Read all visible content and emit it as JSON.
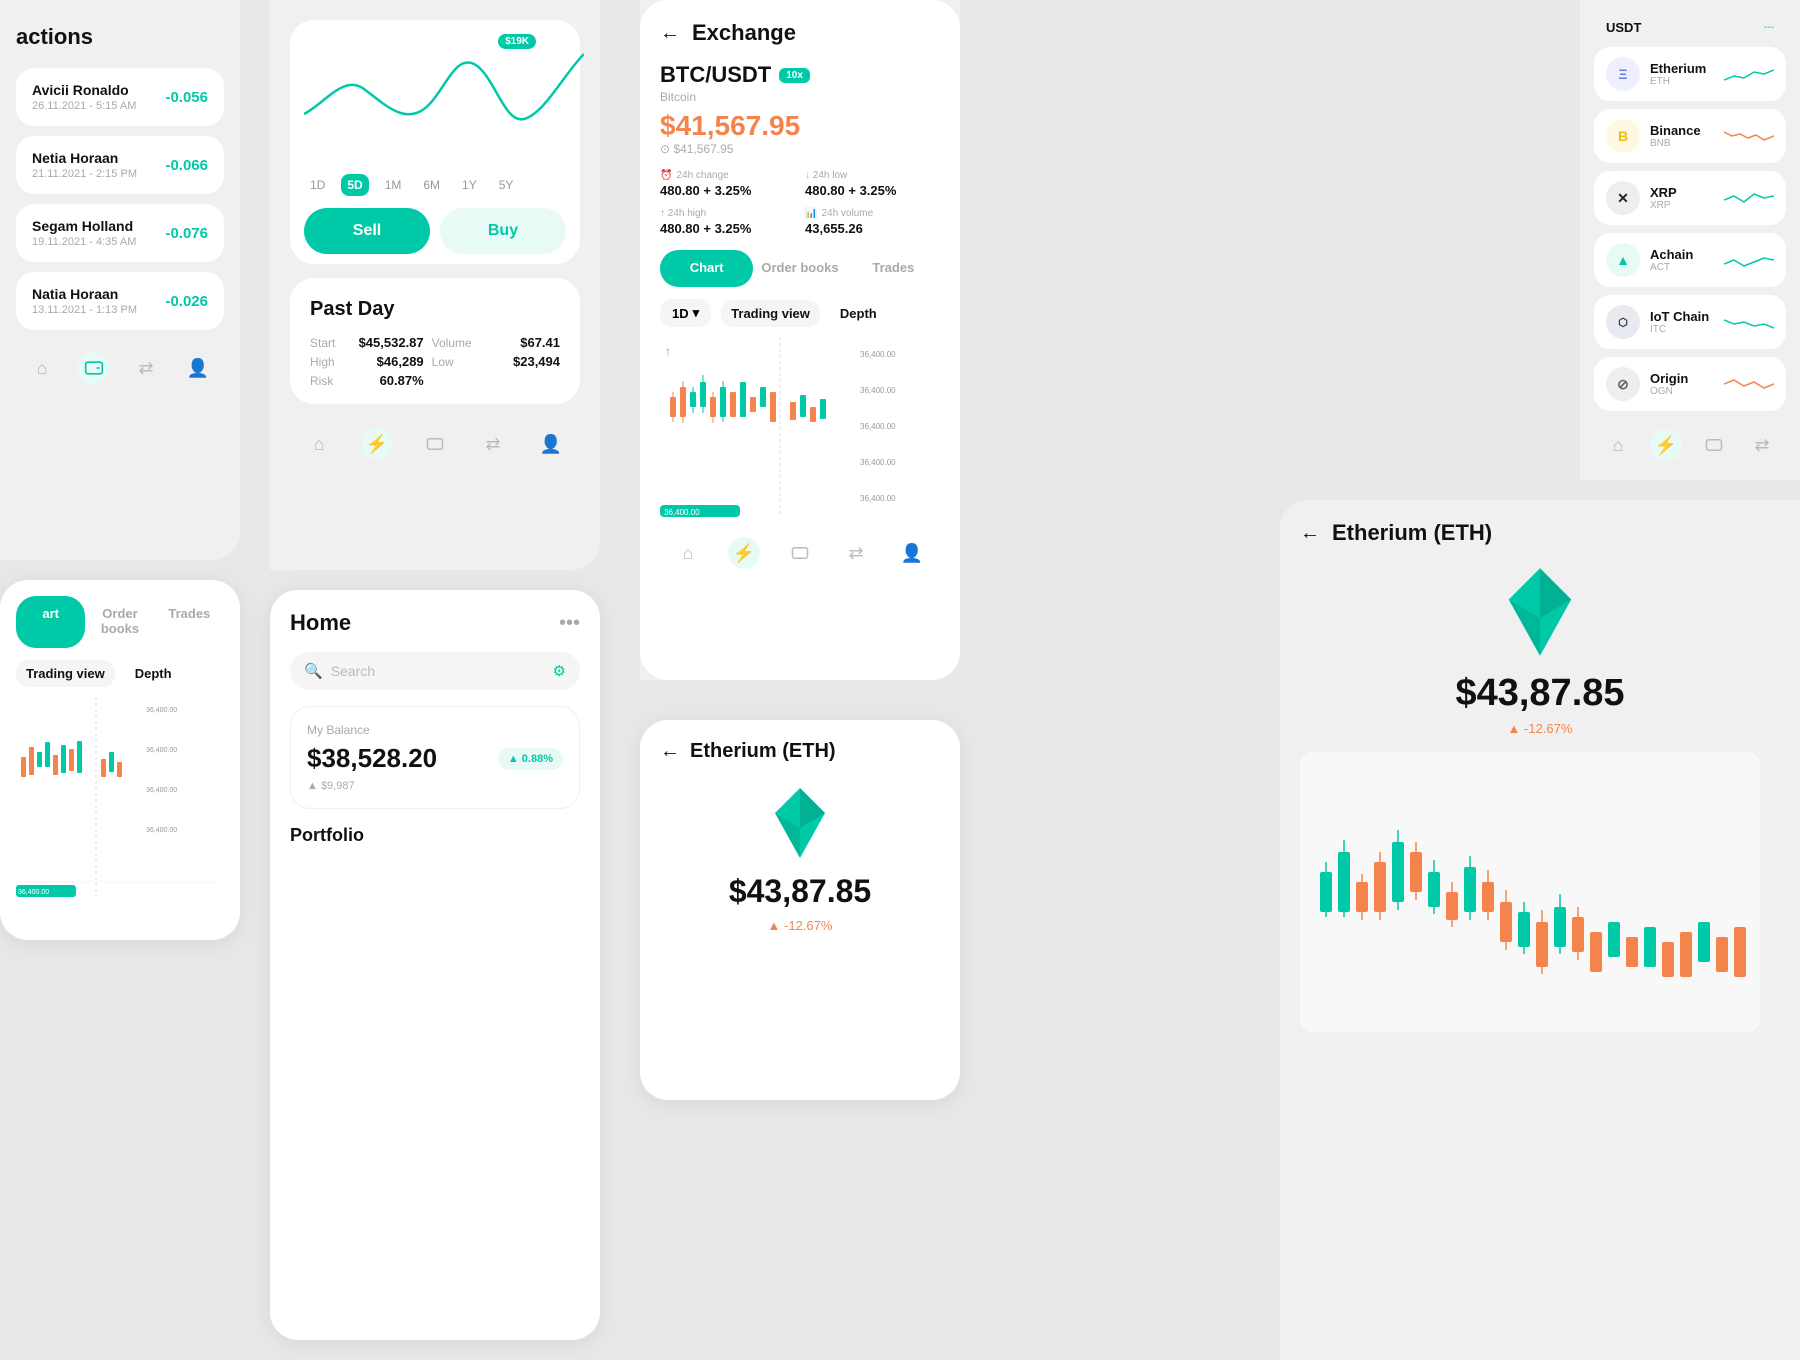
{
  "transactions": {
    "title": "actions",
    "items": [
      {
        "name": "Avicii Ronaldo",
        "date": "26.11.2021 - 5:15 AM",
        "value": "-0.056"
      },
      {
        "name": "Netia Horaan",
        "date": "21.11.2021 - 2:15 PM",
        "value": "-0.066"
      },
      {
        "name": "Segam Holland",
        "date": "19.11.2021 - 4:35 AM",
        "value": "-0.076"
      },
      {
        "name": "Natia Horaan",
        "date": "13.11.2021 - 1:13 PM",
        "value": "-0.026"
      }
    ]
  },
  "chart": {
    "price_badge": "$19K",
    "time_filters": [
      "1D",
      "5D",
      "1M",
      "6M",
      "1Y",
      "5Y"
    ],
    "active_filter": "5D",
    "sell_label": "Sell",
    "buy_label": "Buy"
  },
  "past_day": {
    "title": "Past Day",
    "start_label": "Start",
    "start_val": "$45,532.87",
    "volume_label": "Volume",
    "volume_val": "$67.41",
    "high_label": "High",
    "high_val": "$46,289",
    "low_label": "Low",
    "low_val": "$23,494",
    "risk_label": "Risk",
    "risk_val": "60.87%"
  },
  "exchange": {
    "title": "Exchange",
    "back": "←",
    "pair": "BTC/USDT",
    "leverage": "10x",
    "pair_sub": "Bitcoin",
    "price": "$41,567.95",
    "price2": "⊙ $41,567.95",
    "change_24h_label": "24h change",
    "change_24h_val": "480.80 + 3.25%",
    "low_24h_label": "↓ 24h low",
    "low_24h_val": "480.80 + 3.25%",
    "high_24h_label": "↑ 24h high",
    "high_24h_val": "480.80 + 3.25%",
    "volume_24h_label": "24h volume",
    "volume_24h_val": "43,655.26",
    "tabs": [
      "Chart",
      "Order books",
      "Trades"
    ],
    "active_tab": "Chart",
    "view_options": [
      "1D",
      "Trading view",
      "Depth"
    ],
    "active_view": "Trading view",
    "price_levels": [
      "36,400.00",
      "36,400.00",
      "36,400.00",
      "36,400.00",
      "36,400.00"
    ]
  },
  "coins": {
    "top": {
      "name": "USDT",
      "val": "---"
    },
    "items": [
      {
        "name": "Etherium",
        "sym": "ETH",
        "color": "#6c7ae0",
        "bg": "#eef0ff",
        "letter": "Ξ"
      },
      {
        "name": "Binance",
        "sym": "BNB",
        "color": "#f0b90b",
        "bg": "#fff8e1",
        "letter": "B"
      },
      {
        "name": "XRP",
        "sym": "XRP",
        "color": "#222",
        "bg": "#eee",
        "letter": "✕"
      },
      {
        "name": "Achain",
        "sym": "ACT",
        "color": "#00c9a7",
        "bg": "#e8faf6",
        "letter": "▲"
      },
      {
        "name": "IoT Chain",
        "sym": "ITC",
        "color": "#1a2b4a",
        "bg": "#e8eaf0",
        "letter": "⬡"
      },
      {
        "name": "Origin",
        "sym": "OGN",
        "color": "#666",
        "bg": "#eee",
        "letter": "⊘"
      }
    ]
  },
  "home": {
    "title": "Home",
    "search_placeholder": "Search",
    "balance_label": "My Balance",
    "balance_amount": "$38,528.20",
    "balance_badge": "▲ 0.88%",
    "balance_sub": "▲ $9,987",
    "portfolio_title": "Portfolio"
  },
  "eth_detail": {
    "title": "Etherium (ETH)",
    "back": "←",
    "price": "$43,87.85",
    "change": "▲ -12.67%"
  },
  "eth_right": {
    "title": "Etherium (ETH)",
    "back": "←",
    "price": "$43,87.85",
    "change": "▲ -12.67%"
  },
  "exchange_bl": {
    "tabs": [
      "art",
      "Order books",
      "Trades"
    ],
    "view_options": [
      "Trading view",
      "Depth"
    ]
  }
}
